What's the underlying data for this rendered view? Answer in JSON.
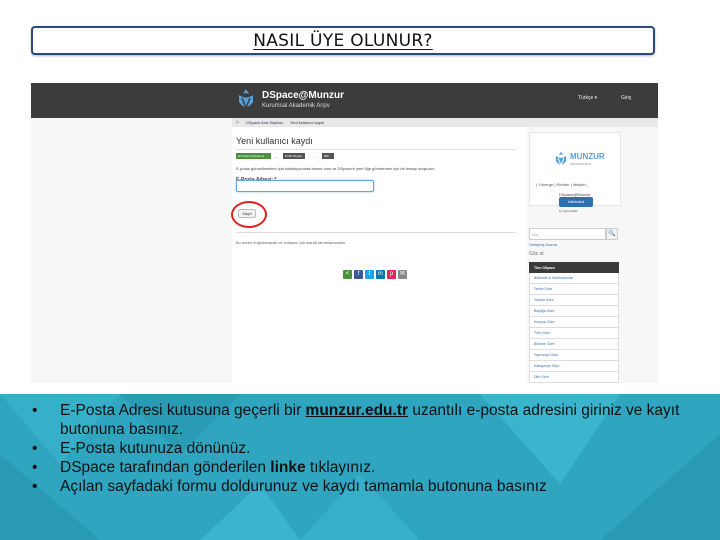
{
  "title": "NASIL ÜYE OLUNUR?",
  "screenshot": {
    "navbar": {
      "brand_name": "DSpace@Munzur",
      "brand_sub": "Kurumsal Akademik Arşiv",
      "language": "Türkçe ▾",
      "login": "Giriş"
    },
    "breadcrumb": {
      "home": "⌂",
      "item1": "DSpace Ana Sayfası",
      "item2": "Yeni kullanıcı kaydı"
    },
    "main": {
      "heading": "Yeni kullanıcı kaydı",
      "steps": [
        "E-Posta Doğrulama",
        "Profil Oluştur",
        "Bitti"
      ],
      "intro": "E-posta güncellemeleri için koleksiyonlara abone olun ve DSpace'e yeni öğe göndermek için bir hesap oluşturun.",
      "email_label": "E-Posta Adresi: *",
      "email_value": "",
      "help_text": "Bu adres doğrulanacak ve kullanıcı adı olarak tanımlanacaktır.",
      "register_button": "Kayıt",
      "share_colors": [
        "#4b8f3a",
        "#3b5998",
        "#1da1f2",
        "#0077b5",
        "#e0245e",
        "#888888"
      ]
    },
    "sidebar": {
      "munzur": "MUNZUR",
      "university": "ÜNİVERSİTESİ",
      "links": "| Yönerge | Rehber | İletişim |",
      "dspace": "DSpace@Munzur",
      "badge": "Validated",
      "openaire": "by OpenAIRE",
      "search_placeholder": "Ara",
      "search_button": "🔍",
      "advanced": "Gelişmiş Arama",
      "browse": "Göz at",
      "browse_items": [
        "Tüm DSpace",
        "Bölümler & Koleksiyonlar",
        "Tarihe Göre",
        "Yazara Göre",
        "Başlığa Göre",
        "Konuya Göre",
        "Türe Göre",
        "Bölüme Göre",
        "Yayıncıya Göre",
        "Kategoriye Göre",
        "Dile Göre"
      ]
    }
  },
  "bullets": [
    {
      "pre": "E-Posta Adresi kutusuna geçerli bir ",
      "strong": "munzur.edu.tr",
      "post": " uzantılı e-posta adresini giriniz ve kayıt butonuna basınız."
    },
    {
      "pre": "E-Posta kutunuza dönünüz.",
      "strong": "",
      "post": ""
    },
    {
      "pre": "DSpace tarafından gönderilen ",
      "bold": "linke",
      "post": " tıklayınız."
    },
    {
      "pre": "Açılan sayfadaki formu doldurunuz ve kaydı tamamla butonuna basınız",
      "strong": "",
      "post": ""
    }
  ],
  "colors": {
    "teal": "#2fa5c0",
    "title_border": "#2b4a7a",
    "navbar": "#3c3c3c",
    "highlight_circle": "#e02020"
  }
}
